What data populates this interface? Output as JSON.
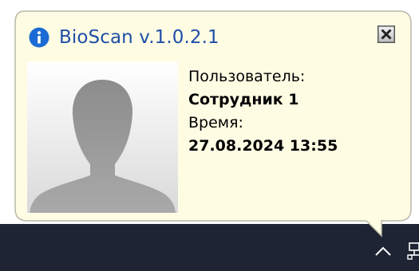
{
  "notification": {
    "title": "BioScan v.1.0.2.1",
    "user_label": "Пользователь:",
    "user_value": "Сотрудник 1",
    "time_label": "Время:",
    "time_value": "27.08.2024 13:55",
    "icon": "info-icon",
    "close_icon": "close-icon"
  },
  "taskbar": {
    "tray_icons": [
      "chevron-up-icon",
      "network-icon"
    ]
  },
  "colors": {
    "balloon_background": "#fefde4",
    "title": "#1f4ea8",
    "info_icon": "#1c6bd4",
    "taskbar": "#1e2433"
  }
}
